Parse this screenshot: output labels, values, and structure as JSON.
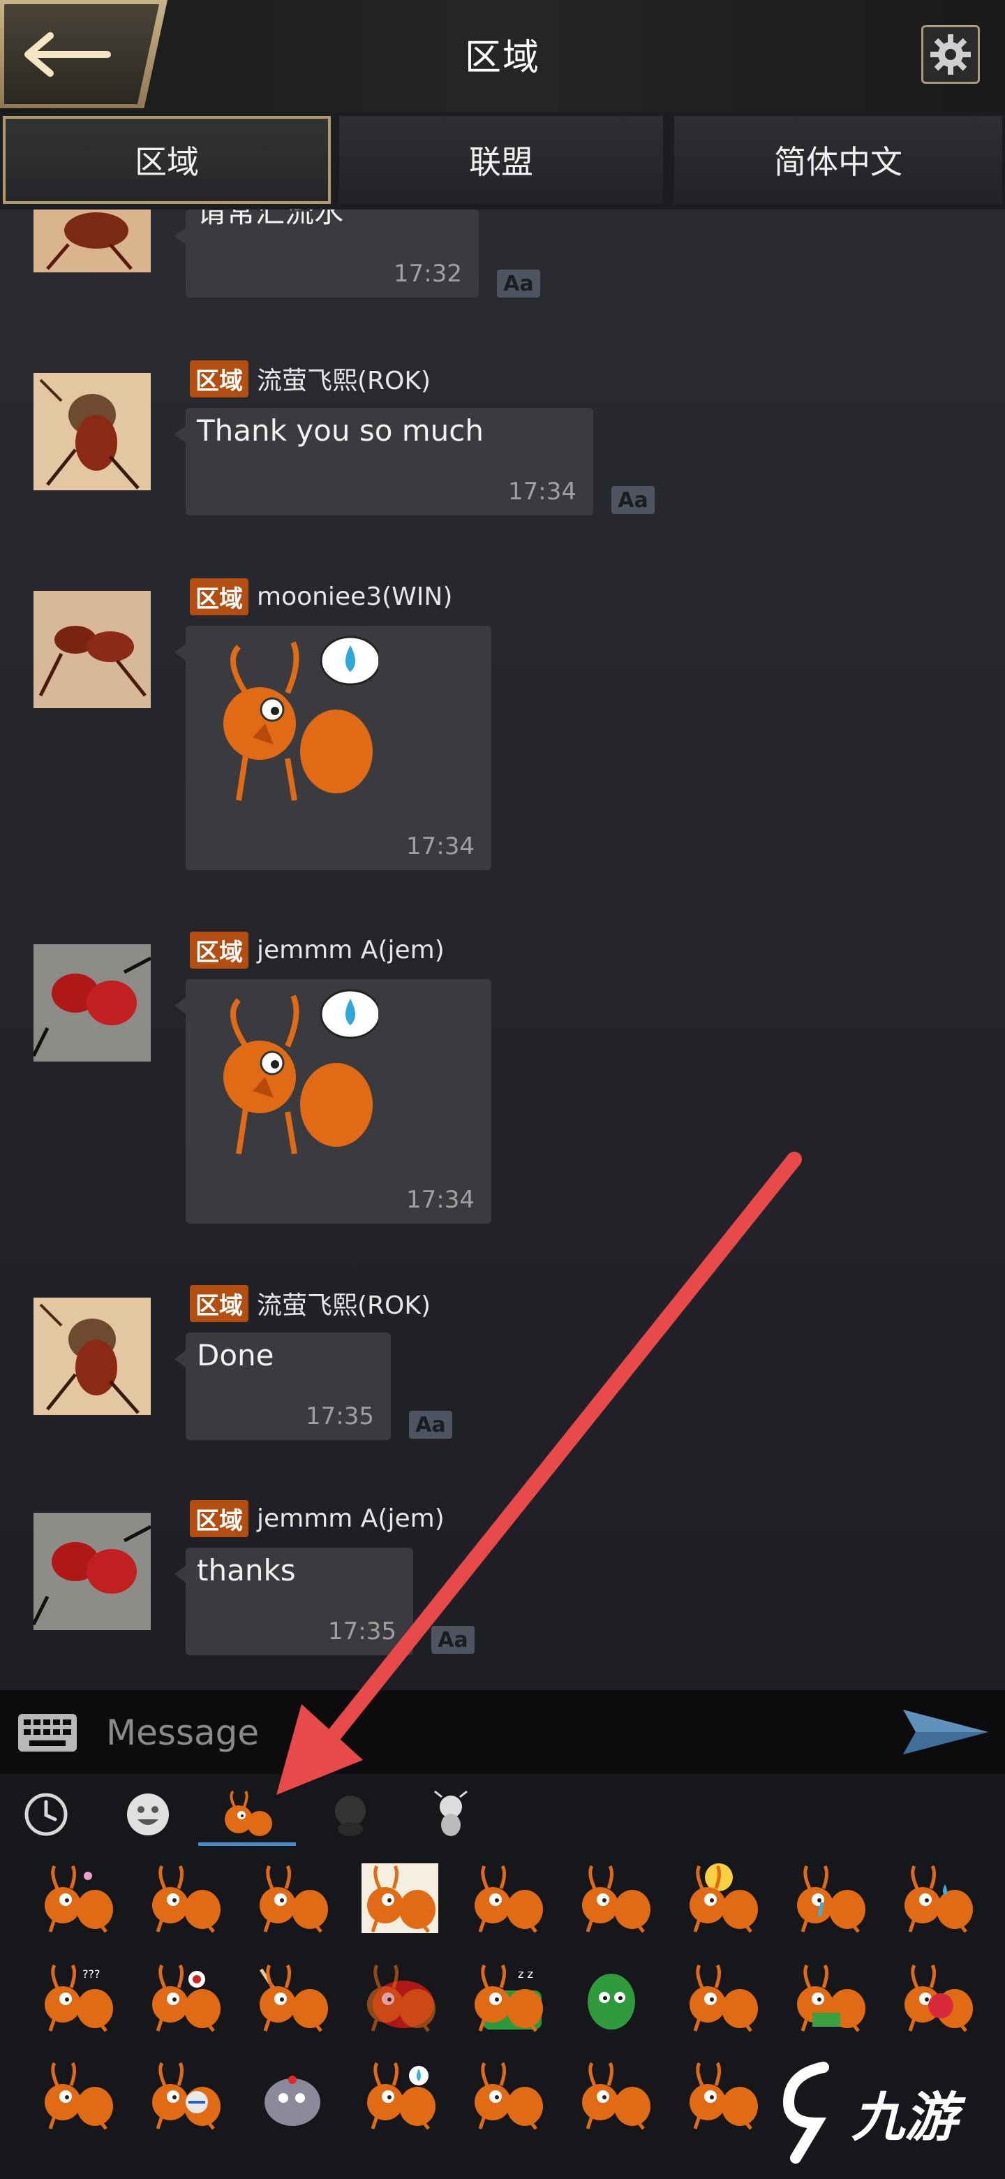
{
  "header": {
    "title": "区域",
    "back_icon": "back-arrow-icon",
    "settings_icon": "gear-icon"
  },
  "tabs": [
    {
      "label": "区域",
      "active": true
    },
    {
      "label": "联盟",
      "active": false
    },
    {
      "label": "简体中文",
      "active": false
    }
  ],
  "messages": [
    {
      "channel": "区域",
      "user": "",
      "text": "请常汇流水",
      "time": "17:32",
      "translatable": true
    },
    {
      "channel": "区域",
      "user": "流萤飞熙(ROK)",
      "text": "Thank you so much",
      "time": "17:34",
      "translatable": true
    },
    {
      "channel": "区域",
      "user": "mooniee3(WIN)",
      "sticker": "sweating-ant-sticker",
      "time": "17:34"
    },
    {
      "channel": "区域",
      "user": "jemmm A(jem)",
      "sticker": "sweating-ant-sticker",
      "time": "17:34"
    },
    {
      "channel": "区域",
      "user": "流萤飞熙(ROK)",
      "text": "Done",
      "time": "17:35",
      "translatable": true
    },
    {
      "channel": "区域",
      "user": "jemmm A(jem)",
      "text": "thanks",
      "time": "17:35",
      "translatable": true
    }
  ],
  "translate_label": "Aa",
  "input": {
    "placeholder": "Message",
    "keyboard_icon": "keyboard-icon",
    "send_icon": "send-icon"
  },
  "emoji_tabs": [
    {
      "icon": "clock-icon",
      "active": false
    },
    {
      "icon": "smiley-icon",
      "active": false
    },
    {
      "icon": "ant-sticker-icon",
      "active": true
    },
    {
      "icon": "dark-sticker-icon",
      "active": false
    },
    {
      "icon": "white-sticker-icon",
      "active": false
    }
  ],
  "colors": {
    "accent_orange": "#b34e10",
    "annotation_red": "#e84a4a",
    "ant_orange": "#e06b14",
    "tab_border": "#b09a6a"
  },
  "watermark": {
    "text": "九游"
  }
}
